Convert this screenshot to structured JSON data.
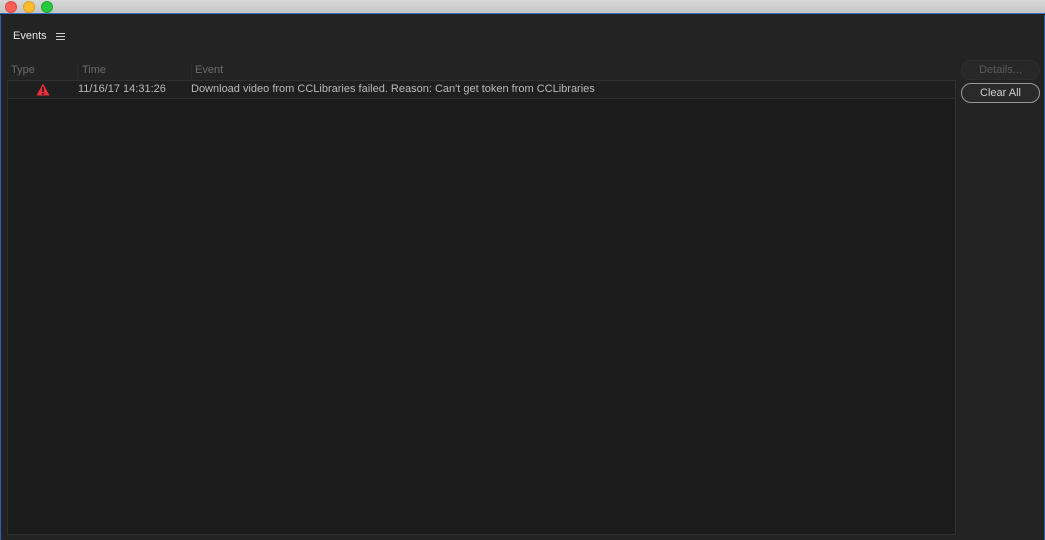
{
  "window": {
    "controls": [
      "close",
      "minimize",
      "zoom"
    ]
  },
  "panel": {
    "title": "Events",
    "menu_icon": "hamburger-menu-icon"
  },
  "table": {
    "columns": [
      "Type",
      "Time",
      "Event"
    ],
    "rows": [
      {
        "type_icon": "warning-icon",
        "time": "11/16/17 14:31:26",
        "event": "Download video from CCLibraries failed. Reason: Can't get token from CCLibraries"
      }
    ]
  },
  "buttons": {
    "details": "Details...",
    "clear_all": "Clear All"
  },
  "colors": {
    "warning": "#e8303a",
    "background": "#232323"
  }
}
